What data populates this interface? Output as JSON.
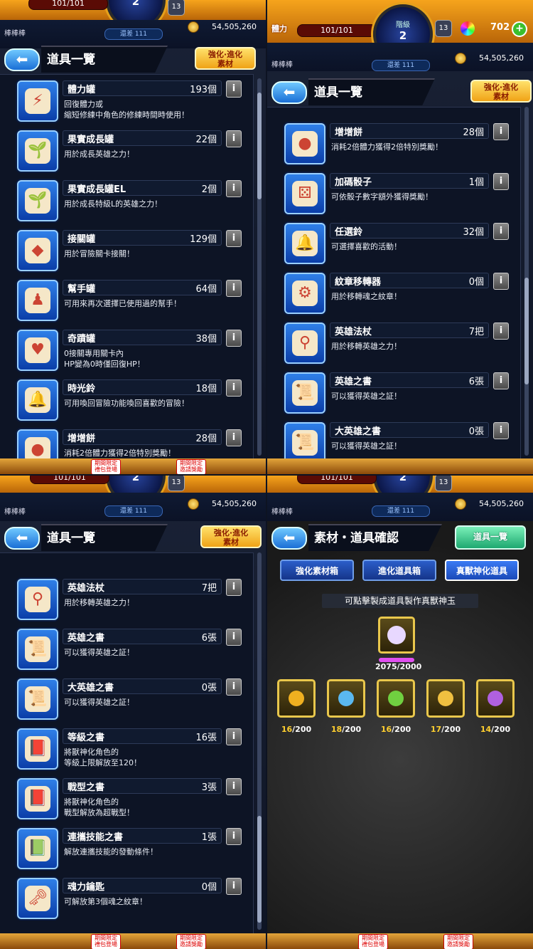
{
  "status": {
    "hp_label": "體力",
    "hp_value": "101/101",
    "rank_label": "階級",
    "rank_value": "2",
    "stamina_badge": "13",
    "orbs": "702",
    "plus": "+",
    "username": "棒棒棒",
    "rank_diff": "還差 111",
    "gold": "54,505,260"
  },
  "header": {
    "title": "道具一覽",
    "back_icon": "back-arrow-icon",
    "enhance_btn_line1": "強化·進化",
    "enhance_btn_line2": "素材"
  },
  "q1_items": [
    {
      "name": "體力罐",
      "count": "193個",
      "desc": "回復體力或\n縮短修練中角色的修練時間時使用！",
      "icon": "stamina-can-icon",
      "glyph": "⚡"
    },
    {
      "name": "果實成長罐",
      "count": "22個",
      "desc": "用於成長英雄之力！",
      "icon": "fruit-growth-can-icon",
      "glyph": "🌱"
    },
    {
      "name": "果實成長罐EL",
      "count": "2個",
      "desc": "用於成長特級L的英雄之力！",
      "icon": "fruit-growth-can-el-icon",
      "glyph": "🌱"
    },
    {
      "name": "接關罐",
      "count": "129個",
      "desc": "用於冒險關卡接關！",
      "icon": "continue-can-icon",
      "glyph": "◆"
    },
    {
      "name": "幫手罐",
      "count": "64個",
      "desc": "可用來再次選擇已使用過的幫手！",
      "icon": "helper-can-icon",
      "glyph": "♟"
    },
    {
      "name": "奇蹟罐",
      "count": "38個",
      "desc": "0接關專用關卡內\nHP變為0時僅回復HP！",
      "icon": "miracle-can-icon",
      "glyph": "♥"
    },
    {
      "name": "時光鈴",
      "count": "18個",
      "desc": "可用喚回冒險功能喚回喜歡的冒險！",
      "icon": "time-bell-icon",
      "glyph": "🔔"
    },
    {
      "name": "增增餅",
      "count": "28個",
      "desc": "消耗2倍體力獲得2倍特別獎勵！",
      "icon": "double-cookie-icon",
      "glyph": "●"
    }
  ],
  "q2_items": [
    {
      "name": "增增餅",
      "count": "28個",
      "desc": "消耗2倍體力獲得2倍特別獎勵！",
      "icon": "double-cookie-icon",
      "glyph": "●"
    },
    {
      "name": "加碼骰子",
      "count": "1個",
      "desc": "可依骰子數字額外獲得獎勵！",
      "icon": "bonus-dice-icon",
      "glyph": "⚄"
    },
    {
      "name": "任選鈴",
      "count": "32個",
      "desc": "可選擇喜歡的活動！",
      "icon": "choice-bell-icon",
      "glyph": "🔔"
    },
    {
      "name": "紋章移轉器",
      "count": "0個",
      "desc": "用於移轉魂之紋章！",
      "icon": "crest-transfer-icon",
      "glyph": "⚙"
    },
    {
      "name": "英雄法杖",
      "count": "7把",
      "desc": "用於移轉英雄之力！",
      "icon": "hero-staff-icon",
      "glyph": "⚲"
    },
    {
      "name": "英雄之書",
      "count": "6張",
      "desc": "可以獲得英雄之証！",
      "icon": "hero-book-icon",
      "glyph": "📜"
    },
    {
      "name": "大英雄之書",
      "count": "0張",
      "desc": "可以獲得英雄之証！",
      "icon": "great-hero-book-icon",
      "glyph": "📜"
    }
  ],
  "q3_items": [
    {
      "name": "英雄法杖",
      "count": "7把",
      "desc": "用於移轉英雄之力！",
      "icon": "hero-staff-icon",
      "glyph": "⚲"
    },
    {
      "name": "英雄之書",
      "count": "6張",
      "desc": "可以獲得英雄之証！",
      "icon": "hero-book-icon",
      "glyph": "📜"
    },
    {
      "name": "大英雄之書",
      "count": "0張",
      "desc": "可以獲得英雄之証！",
      "icon": "great-hero-book-icon",
      "glyph": "📜"
    },
    {
      "name": "等級之書",
      "count": "16張",
      "desc": "將獸神化角色的\n等級上限解放至120！",
      "icon": "level-book-icon",
      "glyph": "📕"
    },
    {
      "name": "戰型之書",
      "count": "3張",
      "desc": "將獸神化角色的\n戰型解放為超戰型！",
      "icon": "battle-type-book-icon",
      "glyph": "📕"
    },
    {
      "name": "連攜技能之書",
      "count": "1張",
      "desc": "解放連攜技能的發動條件！",
      "icon": "link-skill-book-icon",
      "glyph": "📗"
    },
    {
      "name": "魂力鑰匙",
      "count": "0個",
      "desc": "可解放第3個魂之紋章！",
      "icon": "soul-key-icon",
      "glyph": "🗝"
    }
  ],
  "q4": {
    "title": "素材・道具確認",
    "item_list_btn": "道具一覽",
    "tabs": [
      "強化素材箱",
      "進化道具箱",
      "真獸神化道具"
    ],
    "active_tab": 2,
    "hint": "可點擊製成道具製作真獸神玉",
    "main_ball": {
      "have": "2075",
      "need": "/2000",
      "color": "#e8d8ff",
      "progress": 1.0
    },
    "balls": [
      {
        "have": "16",
        "need": "/200",
        "color": "#f0b020"
      },
      {
        "have": "18",
        "need": "/200",
        "color": "#5ab8f0"
      },
      {
        "have": "16",
        "need": "/200",
        "color": "#70d040"
      },
      {
        "have": "17",
        "need": "/200",
        "color": "#f0c040"
      },
      {
        "have": "14",
        "need": "/200",
        "color": "#b060e0"
      }
    ]
  },
  "bottom_nav": {
    "badge1": "期間限定 禮包登場",
    "badge2": "期間限定 邀請獎勵"
  }
}
